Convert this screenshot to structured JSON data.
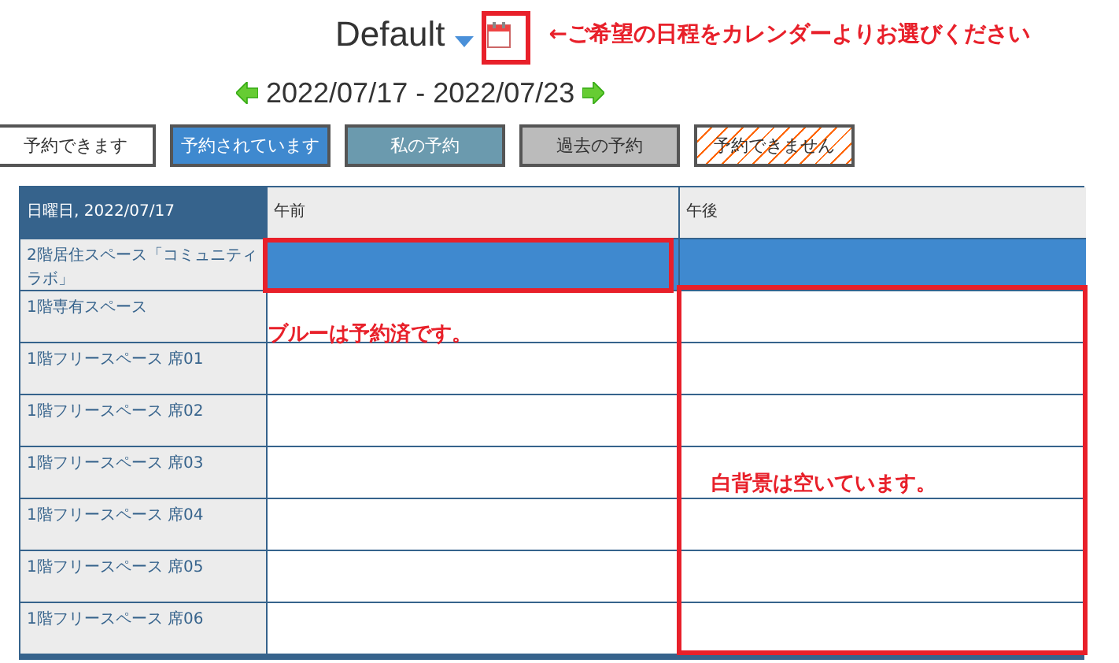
{
  "header": {
    "title": "Default",
    "annotation": "←ご希望の日程をカレンダーよりお選びください"
  },
  "date_range": "2022/07/17 - 2022/07/23",
  "legend": [
    {
      "label": "予約できます",
      "kind": "free"
    },
    {
      "label": "予約されています",
      "kind": "booked"
    },
    {
      "label": "私の予約",
      "kind": "mine"
    },
    {
      "label": "過去の予約",
      "kind": "past"
    },
    {
      "label": "予約できません",
      "kind": "blocked"
    }
  ],
  "table": {
    "columns": [
      "日曜日, 2022/07/17",
      "午前",
      "午後"
    ],
    "rows": [
      {
        "name": "2階居住スペース「コミュニティラボ」",
        "cells": [
          {
            "booked": true
          },
          {
            "booked": true
          }
        ]
      },
      {
        "name": "1階専有スペース",
        "cells": [
          {
            "booked": false
          },
          {
            "booked": false
          }
        ]
      },
      {
        "name": "1階フリースペース 席01",
        "cells": [
          {
            "booked": false
          },
          {
            "booked": false
          }
        ]
      },
      {
        "name": "1階フリースペース 席02",
        "cells": [
          {
            "booked": false
          },
          {
            "booked": false
          }
        ]
      },
      {
        "name": "1階フリースペース 席03",
        "cells": [
          {
            "booked": false
          },
          {
            "booked": false
          }
        ]
      },
      {
        "name": "1階フリースペース 席04",
        "cells": [
          {
            "booked": false
          },
          {
            "booked": false
          }
        ]
      },
      {
        "name": "1階フリースペース 席05",
        "cells": [
          {
            "booked": false
          },
          {
            "booked": false
          }
        ]
      },
      {
        "name": "1階フリースペース 席06",
        "cells": [
          {
            "booked": false
          },
          {
            "booked": false
          }
        ]
      }
    ]
  },
  "notes": [
    "ブルーは予約済です。",
    "白背景は空いています。"
  ]
}
